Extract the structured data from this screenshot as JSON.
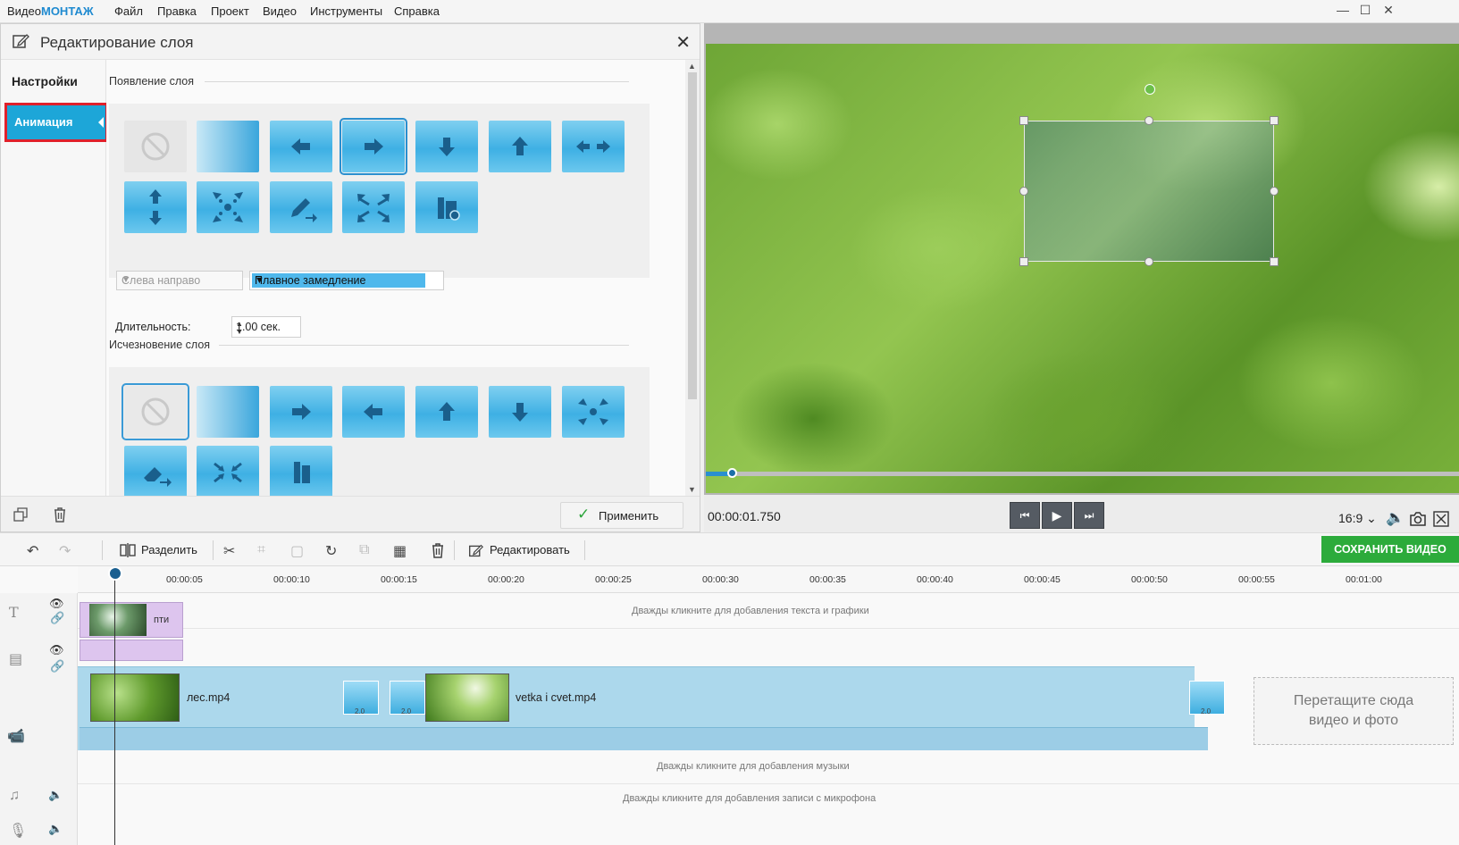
{
  "app": {
    "logo_plain": "Видео",
    "logo_bold": "МОНТАЖ"
  },
  "menu": [
    "Файл",
    "Правка",
    "Проект",
    "Видео",
    "Инструменты",
    "Справка"
  ],
  "window_controls": {
    "minimize": "—",
    "maximize": "☐",
    "close": "✕"
  },
  "edit_panel": {
    "title": "Редактирование слоя",
    "close": "✕",
    "nav": {
      "settings": "Настройки",
      "animation": "Анимация"
    },
    "appear_title": "Появление слоя",
    "disappear_title": "Исчезновение слоя",
    "appear_tiles": [
      "none",
      "fade",
      "arrow-left",
      "arrow-right",
      "arrow-down",
      "arrow-up",
      "arrows-horizontal",
      "arrows-vertical",
      "zoom-in-dots",
      "pencil-draw",
      "expand-corners",
      "building"
    ],
    "appear_selected": "arrow-right",
    "disappear_tiles": [
      "none",
      "fade",
      "arrow-right",
      "arrow-left",
      "arrow-up",
      "arrow-down",
      "collapse-dots",
      "eraser",
      "shrink-corners",
      "building"
    ],
    "disappear_selected": "none",
    "direction_select": "Слева направо",
    "easing_select": "Плавное замедление",
    "duration_label": "Длительность:",
    "duration_value": "1.00 сек.",
    "apply": "Применить"
  },
  "preview": {
    "timecode": "00:00:01.750",
    "progress": 0.035,
    "aspect_ratio": "16:9",
    "ratio_caret": "⌄"
  },
  "toolbar": {
    "split": "Разделить",
    "edit": "Редактировать",
    "save_video": "СОХРАНИТЬ ВИДЕО"
  },
  "timeline": {
    "ticks": [
      "00:00:05",
      "00:00:10",
      "00:00:15",
      "00:00:20",
      "00:00:25",
      "00:00:30",
      "00:00:35",
      "00:00:40",
      "00:00:45",
      "00:00:50",
      "00:00:55",
      "00:01:00"
    ],
    "text_hint": "Дважды кликните для добавления текста и графики",
    "layer_clip": "пти",
    "clips": [
      "лес.mp4",
      "vetka i cvet.mp4"
    ],
    "transition_duration": "2.0",
    "drop_zone_line1": "Перетащите сюда",
    "drop_zone_line2": "видео и фото",
    "music_hint": "Дважды кликните для добавления музыки",
    "mic_hint": "Дважды кликните для добавления записи с микрофона"
  },
  "colors": {
    "accent": "#1da6d8",
    "save": "#2cab3b",
    "highlight_border": "#e0202a"
  }
}
